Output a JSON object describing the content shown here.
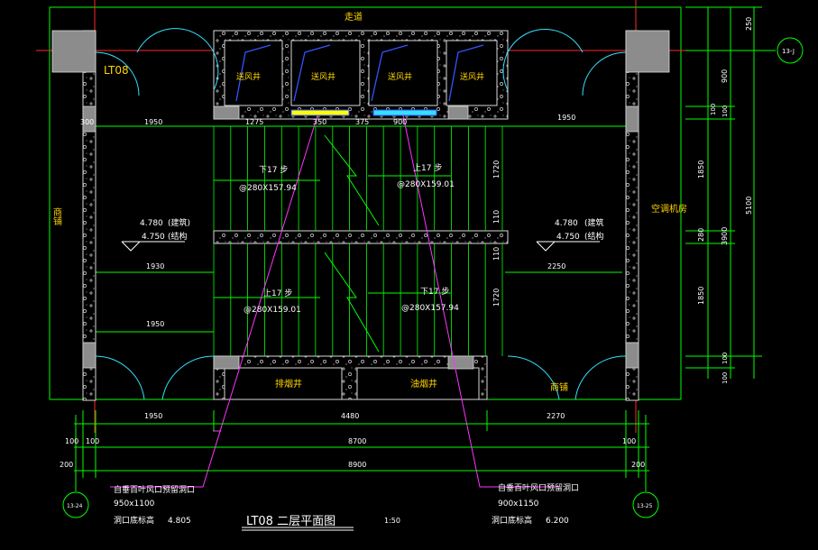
{
  "drawing": {
    "title": "LT08 二层平面图",
    "scale": "1:50",
    "stair_label": "LT08",
    "colors": {
      "background": "#000000",
      "wall": "#d8d8d8",
      "grid": "#00ff00",
      "axis_red": "#ff2a2a",
      "label_yellow": "#ffd400",
      "text_white": "#ffffff",
      "magenta": "#ff33ff",
      "blue": "#3355ff",
      "cyan": "#33e0ff",
      "pink": "#ff55aa"
    },
    "room_labels": {
      "corridor": "走道",
      "shop_left": "商铺",
      "ac_room": "空调机房",
      "shop_bottom": "商铺",
      "smoke_shaft": "排烟井",
      "oil_smoke_shaft": "油烟井",
      "air_shafts": [
        "送风井",
        "送风井",
        "送风井",
        "送风井"
      ]
    },
    "stairs": {
      "upper_down": {
        "steps": "下17 步",
        "spec": "@280X157.94"
      },
      "upper_up": {
        "steps": "上17 步",
        "spec": "@280X159.01"
      },
      "lower_up": {
        "steps": "上17 步",
        "spec": "@280X159.01"
      },
      "lower_down": {
        "steps": "下17 步",
        "spec": "@280X157.94"
      }
    },
    "elevations": {
      "left": {
        "arch": "4.780",
        "arch_label": "(建筑)",
        "struct": "4.750",
        "struct_label": "(结构"
      },
      "right": {
        "arch": "4.780",
        "arch_label": "(建筑",
        "struct": "4.750",
        "struct_label": "(结构"
      }
    },
    "dimensions": {
      "d300": "300",
      "d1950a": "1950",
      "d1275": "1275",
      "d350": "350",
      "d375": "375",
      "d900": "900",
      "d1950b": "1950",
      "d1930": "1930",
      "d2250": "2250",
      "d1950c": "1950",
      "d1720a": "1720",
      "d110a": "110",
      "d110b": "110",
      "d1720b": "1720",
      "b1950": "1950",
      "b4480": "4480",
      "b2270": "2270",
      "b100a": "100",
      "b100b": "100",
      "b8700": "8700",
      "b100c": "100",
      "b200a": "200",
      "b8900": "8900",
      "b200b": "200",
      "r250": "250",
      "r900": "900",
      "r100a": "100",
      "r100b": "100",
      "r1850a": "1850",
      "r280": "280",
      "r3900": "3900",
      "r5100": "5100",
      "r1850b": "1850",
      "r100c": "100",
      "r100d": "100"
    },
    "axis_bubbles": {
      "right_top": "13-J",
      "bottom_left": "13-24",
      "bottom_right": "13-25"
    },
    "notes": {
      "left": {
        "line1": "自垂百叶风口预留洞口",
        "line2": "950x1100",
        "line3": "洞口底标高",
        "line4": "4.805"
      },
      "right": {
        "line1": "自垂百叶风口预留洞口",
        "line2": "900x1150",
        "line3": "洞口底标高",
        "line4": "6.200"
      }
    }
  }
}
